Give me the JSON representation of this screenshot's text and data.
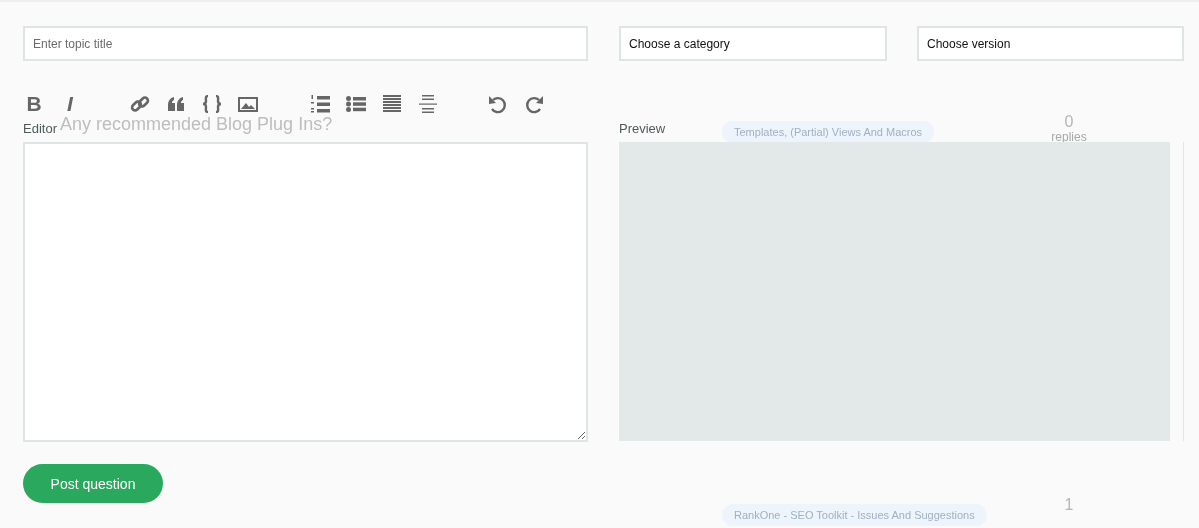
{
  "background_topics": [
    {
      "title": "Any recommended Blog Plug Ins?",
      "tag": "Templates, (Partial) Views And Macros",
      "count": "0",
      "count_label": "replies"
    },
    {
      "tag": "RankOne - SEO Toolkit - Issues And Suggestions",
      "count": "1"
    }
  ],
  "form": {
    "title_field": {
      "placeholder": "Enter topic title"
    },
    "category_select": {
      "value": "Choose a category"
    },
    "version_select": {
      "value": "Choose version"
    },
    "toolbar": [
      {
        "kind": "bold",
        "label": "B"
      },
      {
        "kind": "italic",
        "label": "I"
      },
      {
        "kind": "link"
      },
      {
        "kind": "quote"
      },
      {
        "kind": "code"
      },
      {
        "kind": "image"
      },
      {
        "kind": "ordered-list"
      },
      {
        "kind": "bullet-list"
      },
      {
        "kind": "justify"
      },
      {
        "kind": "rule"
      },
      {
        "kind": "undo"
      },
      {
        "kind": "redo"
      }
    ],
    "editor_label": "Editor",
    "preview_label": "Preview",
    "submit": "Post question"
  }
}
